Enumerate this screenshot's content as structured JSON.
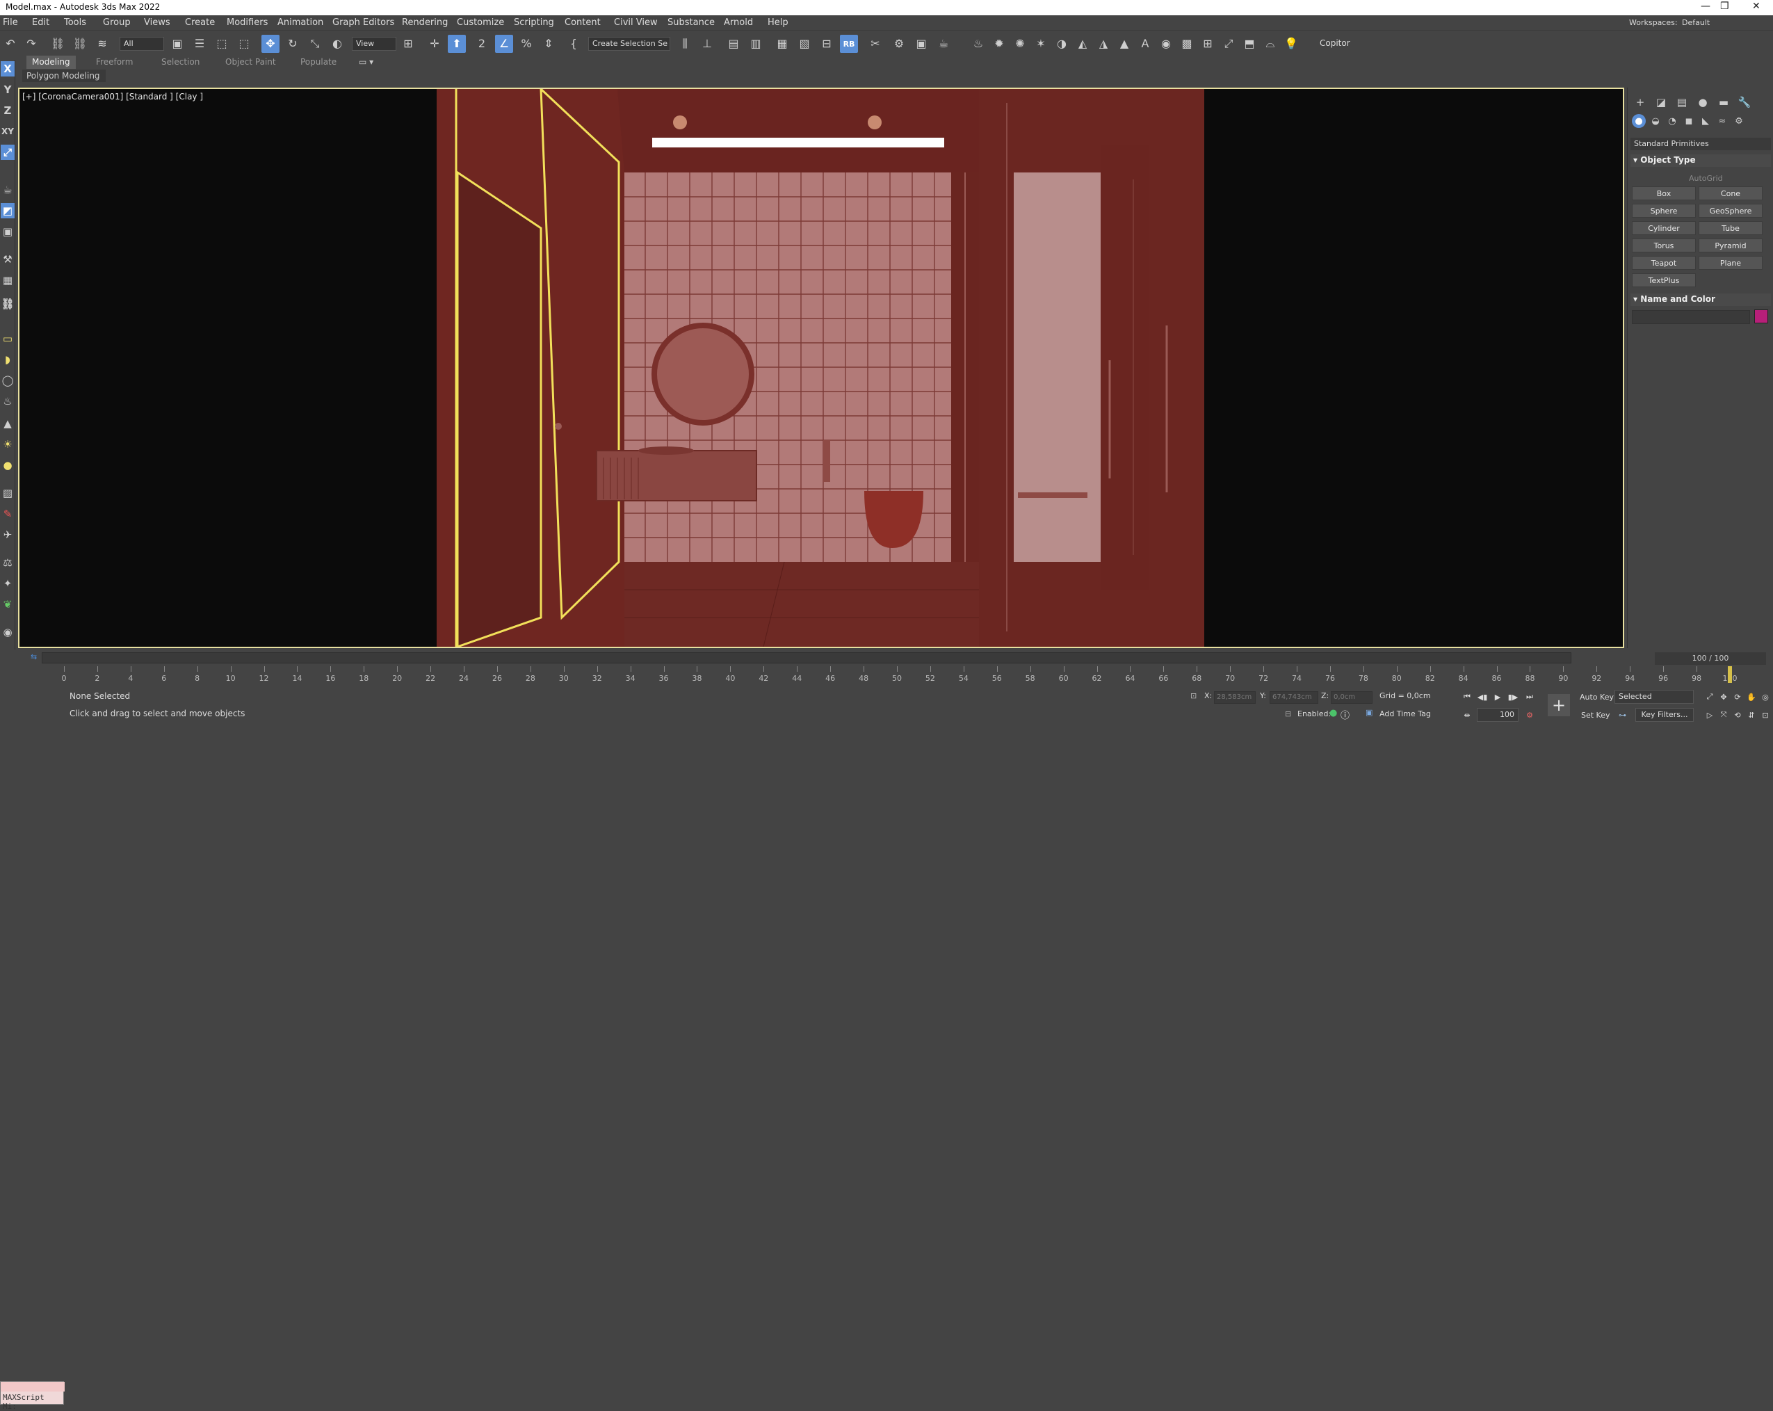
{
  "titlebar": {
    "title": "Model.max - Autodesk 3ds Max 2022",
    "minimize": "—",
    "restore": "❐",
    "close": "✕"
  },
  "menubar": {
    "items": [
      "File",
      "Edit",
      "Tools",
      "Group",
      "Views",
      "Create",
      "Modifiers",
      "Animation",
      "Graph Editors",
      "Rendering",
      "Customize",
      "Scripting",
      "Content",
      "Civil View",
      "Substance",
      "Arnold",
      "Help"
    ],
    "workspaces_label": "Workspaces:",
    "workspaces_value": "Default"
  },
  "toolbar": {
    "selection_filter": "All",
    "ref_coord": "View",
    "named_selection": "Create Selection Se",
    "copitor": "Copitor",
    "rb": "RB"
  },
  "ribbon": {
    "tabs": [
      "Modeling",
      "Freeform",
      "Selection",
      "Object Paint",
      "Populate"
    ],
    "active_tab": "Modeling",
    "sub_label": "Polygon Modeling"
  },
  "left_tools": [
    "X",
    "Y",
    "Z",
    "XY"
  ],
  "viewport": {
    "label": "[+] [CoronaCamera001] [Standard ] [Clay ]"
  },
  "command_panel": {
    "primitive_type": "Standard Primitives",
    "object_type_header": "Object Type",
    "autogrid": "AutoGrid",
    "buttons": [
      "Box",
      "Cone",
      "Sphere",
      "GeoSphere",
      "Cylinder",
      "Tube",
      "Torus",
      "Pyramid",
      "Teapot",
      "Plane",
      "TextPlus"
    ],
    "name_color_header": "Name and Color",
    "object_color": "#b71f79"
  },
  "timeline": {
    "frame_display": "100 / 100",
    "ticks": [
      0,
      2,
      4,
      6,
      8,
      10,
      12,
      14,
      16,
      18,
      20,
      22,
      24,
      26,
      28,
      30,
      32,
      34,
      36,
      38,
      40,
      42,
      44,
      46,
      48,
      50,
      52,
      54,
      56,
      58,
      60,
      62,
      64,
      66,
      68,
      70,
      72,
      74,
      76,
      78,
      80,
      82,
      84,
      86,
      88,
      90,
      92,
      94,
      96,
      98,
      100
    ],
    "current_frame": 100
  },
  "status": {
    "maxscript": "MAXScript Mi:",
    "selection": "None Selected",
    "prompt": "Click and drag to select and move objects",
    "x_label": "X:",
    "x_value": "28,583cm",
    "y_label": "Y:",
    "y_value": "674,743cm",
    "z_label": "Z:",
    "z_value": "0,0cm",
    "grid": "Grid = 0,0cm",
    "enabled": "Enabled:",
    "add_time_tag": "Add Time Tag",
    "auto_key": "Auto Key",
    "set_key": "Set Key",
    "selected_dropdown": "Selected",
    "key_filters": "Key Filters...",
    "frame_field": "100"
  }
}
